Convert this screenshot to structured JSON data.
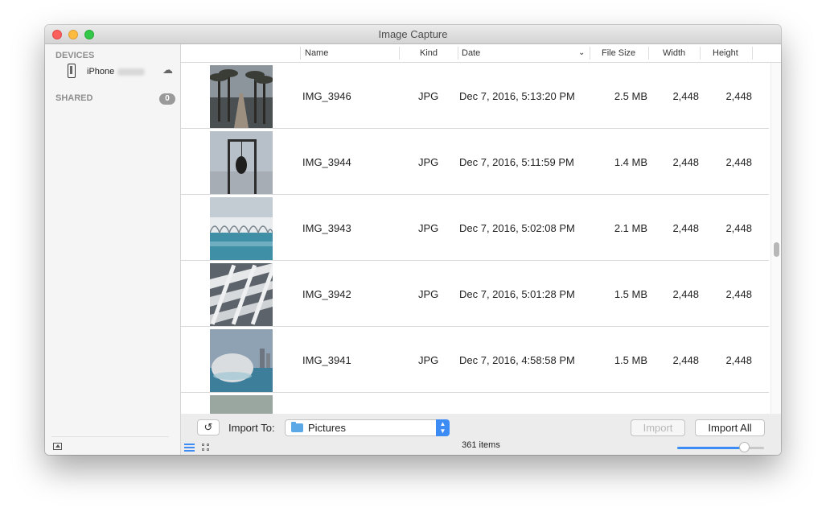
{
  "window": {
    "title": "Image Capture"
  },
  "sidebar": {
    "devices_header": "DEVICES",
    "device_label": "iPhone",
    "shared_header": "SHARED",
    "shared_count": "0"
  },
  "columns": {
    "name": "Name",
    "kind": "Kind",
    "date": "Date",
    "file_size": "File Size",
    "width": "Width",
    "height": "Height"
  },
  "rows": [
    {
      "name": "IMG_3946",
      "kind": "JPG",
      "date": "Dec 7, 2016, 5:13:20 PM",
      "size": "2.5 MB",
      "width": "2,448",
      "height": "2,448",
      "thumb": "palm-trees-walkway"
    },
    {
      "name": "IMG_3944",
      "kind": "JPG",
      "date": "Dec 7, 2016, 5:11:59 PM",
      "size": "1.4 MB",
      "width": "2,448",
      "height": "2,448",
      "thumb": "hanging-sculpture"
    },
    {
      "name": "IMG_3943",
      "kind": "JPG",
      "date": "Dec 7, 2016, 5:02:08 PM",
      "size": "2.1 MB",
      "width": "2,448",
      "height": "2,448",
      "thumb": "white-arches-pool"
    },
    {
      "name": "IMG_3942",
      "kind": "JPG",
      "date": "Dec 7, 2016, 5:01:28 PM",
      "size": "1.5 MB",
      "width": "2,448",
      "height": "2,448",
      "thumb": "white-lattice-structure"
    },
    {
      "name": "IMG_3941",
      "kind": "JPG",
      "date": "Dec 7, 2016, 4:58:58 PM",
      "size": "1.5 MB",
      "width": "2,448",
      "height": "2,448",
      "thumb": "dome-building-water"
    }
  ],
  "bottom": {
    "import_to_label": "Import To:",
    "destination": "Pictures",
    "import_button": "Import",
    "import_all_button": "Import All",
    "item_count": "361 items"
  },
  "thumbnail_size_level": 0.77,
  "colors": {
    "accent": "#3d8cf5",
    "close": "#fc605c",
    "minimize": "#fdbc40",
    "maximize": "#34c84a"
  },
  "icons": [
    "phone-icon",
    "cloud-icon",
    "rotate-icon",
    "folder-icon",
    "list-view-icon",
    "grid-view-icon",
    "sidebar-toggle-icon",
    "sort-chevron-icon"
  ]
}
